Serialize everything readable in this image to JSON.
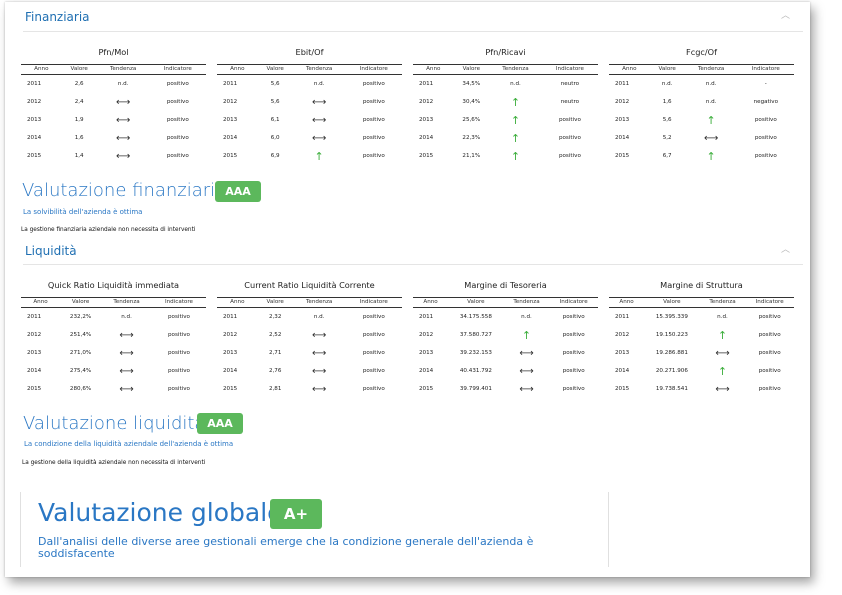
{
  "finanziaria": {
    "title": "Finanziaria",
    "collapse_icon": "chevron-up-icon",
    "headers": [
      "Anno",
      "Valore",
      "Tendenza",
      "Indicatore"
    ],
    "metrics": [
      {
        "title": "Pfn/Mol",
        "rows": [
          {
            "anno": "2011",
            "valore": "2,6",
            "tendenza": "n.d.",
            "indicatore": "positivo"
          },
          {
            "anno": "2012",
            "valore": "2,4",
            "tendenza": "flat",
            "indicatore": "positivo"
          },
          {
            "anno": "2013",
            "valore": "1,9",
            "tendenza": "flat",
            "indicatore": "positivo"
          },
          {
            "anno": "2014",
            "valore": "1,6",
            "tendenza": "flat",
            "indicatore": "positivo"
          },
          {
            "anno": "2015",
            "valore": "1,4",
            "tendenza": "flat",
            "indicatore": "positivo"
          }
        ]
      },
      {
        "title": "Ebit/Of",
        "rows": [
          {
            "anno": "2011",
            "valore": "5,6",
            "tendenza": "n.d.",
            "indicatore": "positivo"
          },
          {
            "anno": "2012",
            "valore": "5,6",
            "tendenza": "flat",
            "indicatore": "positivo"
          },
          {
            "anno": "2013",
            "valore": "6,1",
            "tendenza": "flat",
            "indicatore": "positivo"
          },
          {
            "anno": "2014",
            "valore": "6,0",
            "tendenza": "flat",
            "indicatore": "positivo"
          },
          {
            "anno": "2015",
            "valore": "6,9",
            "tendenza": "up",
            "indicatore": "positivo"
          }
        ]
      },
      {
        "title": "Pfn/Ricavi",
        "rows": [
          {
            "anno": "2011",
            "valore": "34,5%",
            "tendenza": "n.d.",
            "indicatore": "neutro"
          },
          {
            "anno": "2012",
            "valore": "30,4%",
            "tendenza": "up",
            "indicatore": "neutro"
          },
          {
            "anno": "2013",
            "valore": "25,6%",
            "tendenza": "up",
            "indicatore": "positivo"
          },
          {
            "anno": "2014",
            "valore": "22,3%",
            "tendenza": "up",
            "indicatore": "positivo"
          },
          {
            "anno": "2015",
            "valore": "21,1%",
            "tendenza": "up",
            "indicatore": "positivo"
          }
        ]
      },
      {
        "title": "Fcgc/Of",
        "rows": [
          {
            "anno": "2011",
            "valore": "n.d.",
            "tendenza": "n.d.",
            "indicatore": "-"
          },
          {
            "anno": "2012",
            "valore": "1,6",
            "tendenza": "n.d.",
            "indicatore": "negativo"
          },
          {
            "anno": "2013",
            "valore": "5,6",
            "tendenza": "up",
            "indicatore": "positivo"
          },
          {
            "anno": "2014",
            "valore": "5,2",
            "tendenza": "flat",
            "indicatore": "positivo"
          },
          {
            "anno": "2015",
            "valore": "6,7",
            "tendenza": "up",
            "indicatore": "positivo"
          }
        ]
      }
    ],
    "evaluation": {
      "title": "Valutazione finanziaria",
      "badge": "AAA",
      "description": "La solvibilità dell'azienda è ottima",
      "note": "La gestione finanziaria aziendale non necessita di interventi"
    }
  },
  "liquidita": {
    "title": "Liquidità",
    "collapse_icon": "chevron-up-icon",
    "headers": [
      "Anno",
      "Valore",
      "Tendenza",
      "Indicatore"
    ],
    "metrics": [
      {
        "title": "Quick Ratio Liquidità immediata",
        "rows": [
          {
            "anno": "2011",
            "valore": "232,2%",
            "tendenza": "n.d.",
            "indicatore": "positivo"
          },
          {
            "anno": "2012",
            "valore": "251,4%",
            "tendenza": "flat",
            "indicatore": "positivo"
          },
          {
            "anno": "2013",
            "valore": "271,0%",
            "tendenza": "flat",
            "indicatore": "positivo"
          },
          {
            "anno": "2014",
            "valore": "275,4%",
            "tendenza": "flat",
            "indicatore": "positivo"
          },
          {
            "anno": "2015",
            "valore": "280,6%",
            "tendenza": "flat",
            "indicatore": "positivo"
          }
        ]
      },
      {
        "title": "Current Ratio Liquidità Corrente",
        "rows": [
          {
            "anno": "2011",
            "valore": "2,32",
            "tendenza": "n.d.",
            "indicatore": "positivo"
          },
          {
            "anno": "2012",
            "valore": "2,52",
            "tendenza": "flat",
            "indicatore": "positivo"
          },
          {
            "anno": "2013",
            "valore": "2,71",
            "tendenza": "flat",
            "indicatore": "positivo"
          },
          {
            "anno": "2014",
            "valore": "2,76",
            "tendenza": "flat",
            "indicatore": "positivo"
          },
          {
            "anno": "2015",
            "valore": "2,81",
            "tendenza": "flat",
            "indicatore": "positivo"
          }
        ]
      },
      {
        "title": "Margine di Tesoreria",
        "rows": [
          {
            "anno": "2011",
            "valore": "34.175.558",
            "tendenza": "n.d.",
            "indicatore": "positivo"
          },
          {
            "anno": "2012",
            "valore": "37.580.727",
            "tendenza": "up",
            "indicatore": "positivo"
          },
          {
            "anno": "2013",
            "valore": "39.232.153",
            "tendenza": "flat",
            "indicatore": "positivo"
          },
          {
            "anno": "2014",
            "valore": "40.431.792",
            "tendenza": "flat",
            "indicatore": "positivo"
          },
          {
            "anno": "2015",
            "valore": "39.799.401",
            "tendenza": "flat",
            "indicatore": "positivo"
          }
        ]
      },
      {
        "title": "Margine di Struttura",
        "rows": [
          {
            "anno": "2011",
            "valore": "15.395.339",
            "tendenza": "n.d.",
            "indicatore": "positivo"
          },
          {
            "anno": "2012",
            "valore": "19.150.223",
            "tendenza": "up",
            "indicatore": "positivo"
          },
          {
            "anno": "2013",
            "valore": "19.286.881",
            "tendenza": "flat",
            "indicatore": "positivo"
          },
          {
            "anno": "2014",
            "valore": "20.271.906",
            "tendenza": "up",
            "indicatore": "positivo"
          },
          {
            "anno": "2015",
            "valore": "19.738.541",
            "tendenza": "flat",
            "indicatore": "positivo"
          }
        ]
      }
    ],
    "evaluation": {
      "title": "Valutazione liquidità",
      "badge": "AAA",
      "description": "La condizione della liquidità aziendale dell'azienda è ottima",
      "note": "La gestione della liquidità aziendale non necessita di interventi"
    }
  },
  "globale": {
    "title": "Valutazione globale",
    "badge": "A+",
    "description": "Dall'analisi delle diverse aree gestionali emerge che la condizione generale dell'azienda è soddisfacente"
  },
  "colors": {
    "accent": "#2a77c4",
    "badge": "#5cb85c",
    "positive": "#3cae3c",
    "negative": "#d93a2b"
  }
}
